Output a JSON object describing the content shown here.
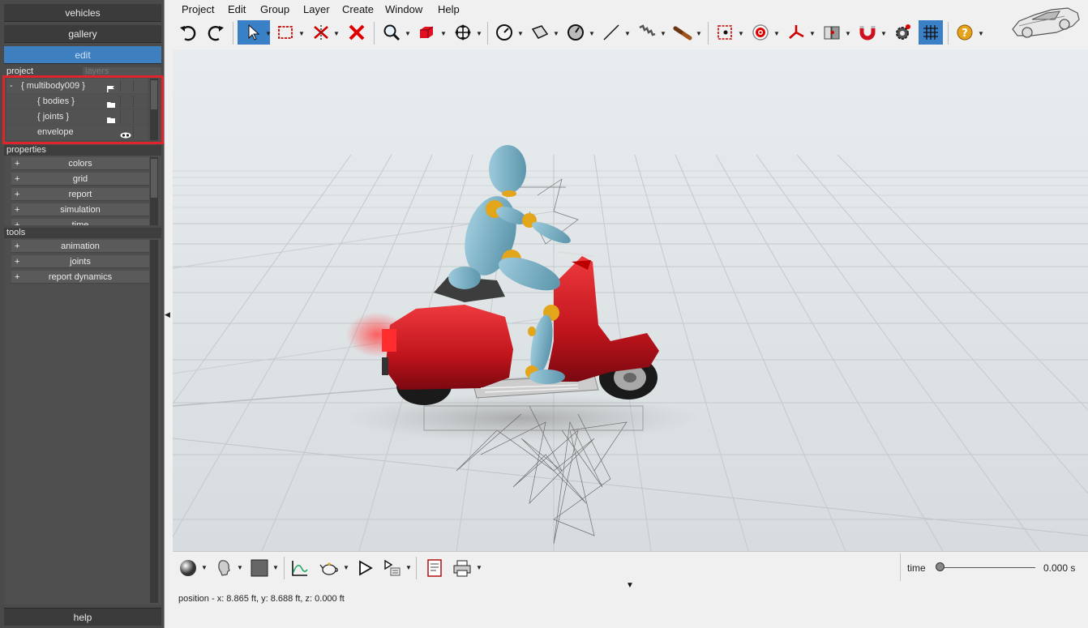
{
  "left_panel": {
    "nav": {
      "vehicles": "vehicles",
      "gallery": "gallery",
      "edit": "edit"
    },
    "project_tabs": {
      "project": "project",
      "layers": "layers"
    },
    "tree": {
      "root": {
        "toggle": "-",
        "label": "{ multibody009 }"
      },
      "bodies": "{ bodies }",
      "joints": "{ joints }",
      "envelope": "envelope"
    },
    "properties": {
      "title": "properties",
      "items": [
        "colors",
        "grid",
        "report",
        "simulation",
        "time"
      ]
    },
    "tools": {
      "title": "tools",
      "items": [
        "animation",
        "joints",
        "report dynamics"
      ]
    },
    "help": "help",
    "highlight_color": "#e0242b"
  },
  "menu": [
    "Project",
    "Edit",
    "Group",
    "Layer",
    "Create",
    "Window",
    "Help"
  ],
  "toolbar_icons": [
    "undo-icon",
    "redo-icon",
    "select-arrow-icon",
    "marquee-select-icon",
    "trim-icon",
    "delete-icon",
    "zoom-icon",
    "box-icon",
    "move-icon",
    "gauge-icon",
    "plane-icon",
    "dial-icon",
    "line-icon",
    "spring-icon",
    "damper-icon",
    "point-icon",
    "target-icon",
    "joint-axes-icon",
    "contact-icon",
    "magnet-icon",
    "gear-settings-icon",
    "grid-toggle-icon",
    "help-icon"
  ],
  "bottom_toolbar_icons": [
    "shading-sphere-icon",
    "human-head-icon",
    "color-swatch-icon",
    "graph-icon",
    "teapot-icon",
    "play-icon",
    "play-steps-icon",
    "report-icon",
    "print-icon"
  ],
  "timeline": {
    "label": "time",
    "value": "0.000 s",
    "position": 0
  },
  "status": "position - x: 8.865 ft, y: 8.688 ft, z: 0.000 ft",
  "colors": {
    "accent": "#3d7fbf",
    "scooter": "#c8161d",
    "dummy": "#7fb6cc",
    "joints": "#e3a51a"
  }
}
